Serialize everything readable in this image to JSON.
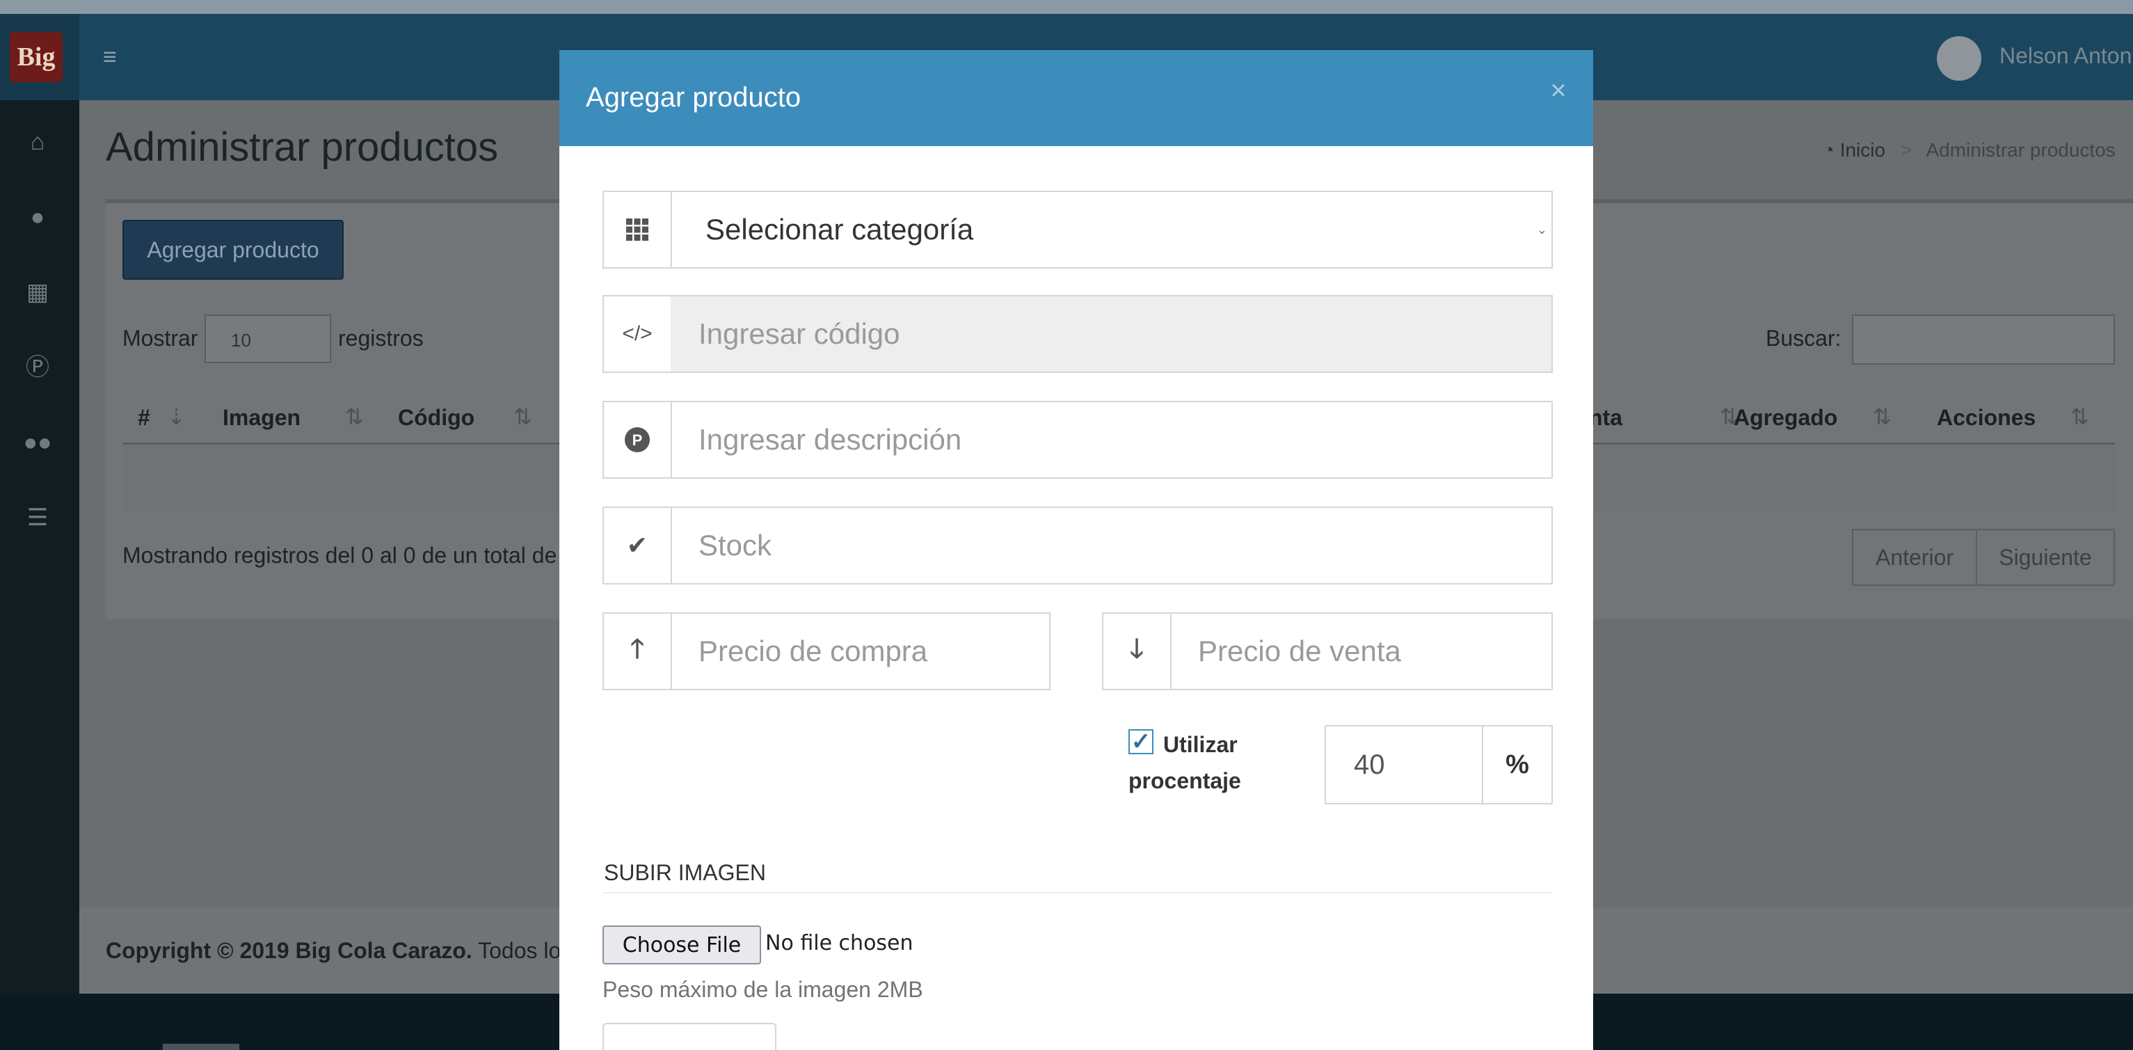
{
  "app": {
    "logo_text": "Big",
    "user_name": "Nelson Anton"
  },
  "header": {
    "menu_icon": "bars-icon"
  },
  "sidebar": {
    "items": [
      {
        "icon": "home-icon"
      },
      {
        "icon": "user-icon"
      },
      {
        "icon": "th-icon"
      },
      {
        "icon": "product-hunt-icon"
      },
      {
        "icon": "users-icon"
      },
      {
        "icon": "list-icon"
      }
    ]
  },
  "page": {
    "title": "Administrar productos",
    "breadcrumb": {
      "home": "Inicio",
      "separator": ">",
      "current": "Administrar productos"
    },
    "add_button": "Agregar producto",
    "show_label": "Mostrar",
    "show_value": "10",
    "records_label": "registros",
    "search_label": "Buscar:",
    "table": {
      "columns": [
        "#",
        "Imagen",
        "Código",
        "nta",
        "Agregado",
        "Acciones"
      ]
    },
    "info": "Mostrando registros del 0 al 0 de un total de",
    "prev": "Anterior",
    "next": "Siguiente"
  },
  "footer": {
    "copyright": "Copyright © 2019 Big Cola Carazo.",
    "rest": " Todos los"
  },
  "modal": {
    "title": "Agregar producto",
    "close": "×",
    "category_placeholder": "Selecionar categoría",
    "code_placeholder": "Ingresar código",
    "description_placeholder": "Ingresar descripción",
    "stock_placeholder": "Stock",
    "buy_price_placeholder": "Precio de compra",
    "sell_price_placeholder": "Precio de venta",
    "use_percentage_label": "Utilizar procentaje",
    "use_percentage_checked": true,
    "percentage_value": "40",
    "percentage_symbol": "%",
    "upload_title": "SUBIR IMAGEN",
    "choose_file": "Choose File",
    "no_file": "No file chosen",
    "max_size": "Peso máximo de la imagen 2MB"
  },
  "colors": {
    "modal_header": "#3c8dbc",
    "header": "#1b4660",
    "sidebar": "#121d22"
  }
}
